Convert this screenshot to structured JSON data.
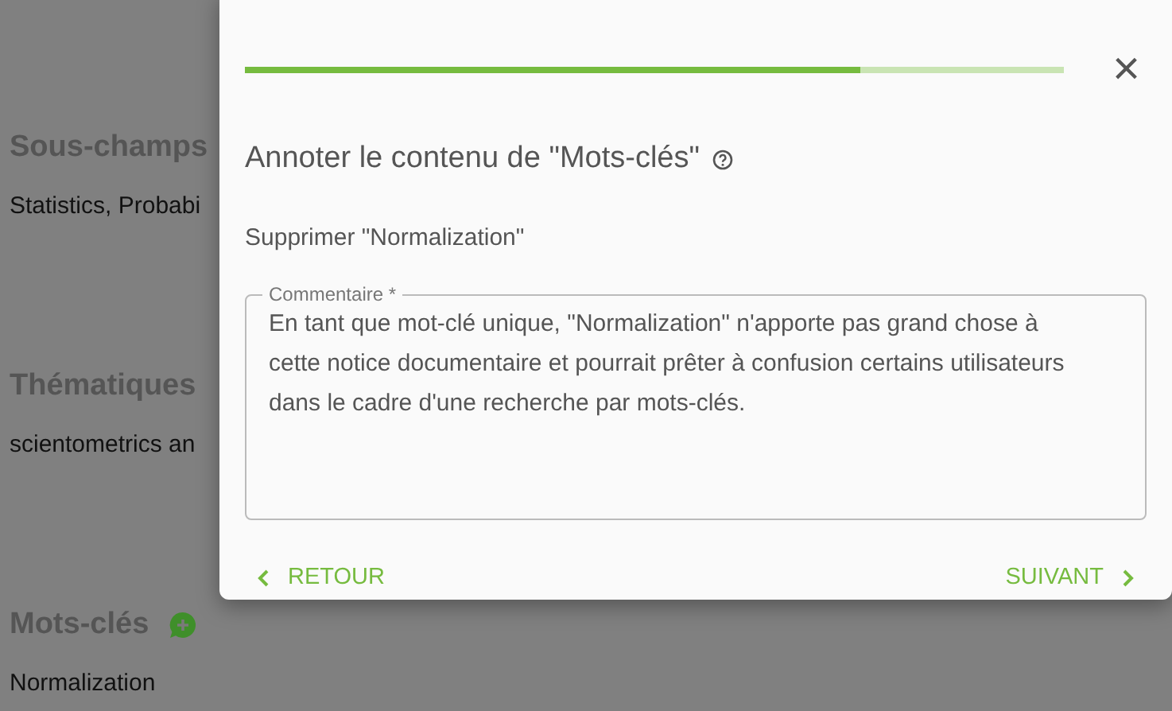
{
  "background_page": {
    "sections": [
      {
        "heading": "Sous-champs",
        "value": "Statistics, Probabi",
        "add_icon": false
      },
      {
        "heading": "Thématiques",
        "value": "scientometrics an",
        "add_icon": false
      },
      {
        "heading": "Mots-clés",
        "value": "Normalization",
        "add_icon": true
      }
    ]
  },
  "dialog": {
    "progress": {
      "level": 0.75
    },
    "close": "×",
    "title": "Annoter le contenu de \"Mots-clés\"",
    "subtitle": "Supprimer \"Normalization\"",
    "comment": {
      "label": "Commentaire *",
      "value": "En tant que mot-clé unique, \"Normalization\" n'apporte pas grand chose à cette notice documentaire et pourrait prêter à confusion certains utilisateurs dans le cadre d'une recherche par mots-clés."
    },
    "back": "RETOUR",
    "next": "SUIVANT"
  }
}
